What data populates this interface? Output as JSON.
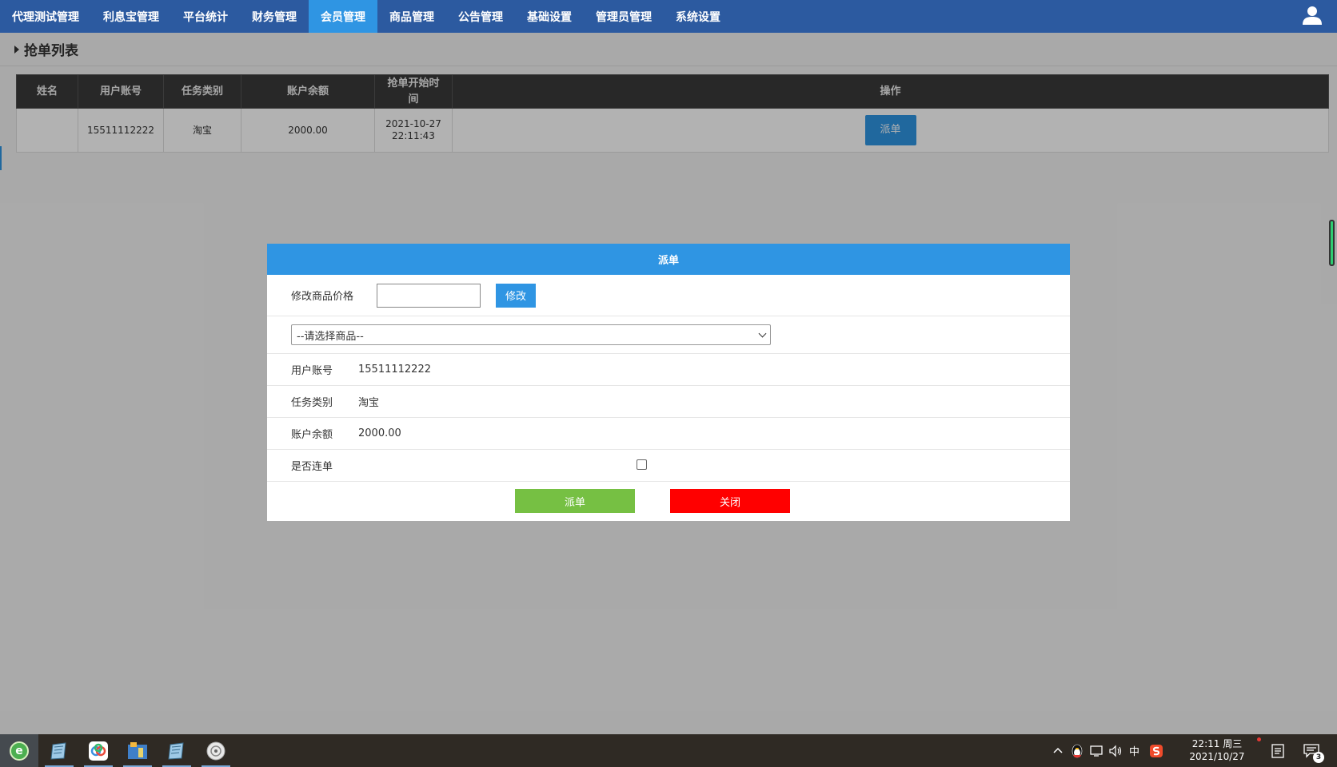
{
  "nav": {
    "items": [
      {
        "label": "代理测试管理"
      },
      {
        "label": "利息宝管理"
      },
      {
        "label": "平台统计"
      },
      {
        "label": "财务管理"
      },
      {
        "label": "会员管理",
        "active": true
      },
      {
        "label": "商品管理"
      },
      {
        "label": "公告管理"
      },
      {
        "label": "基础设置"
      },
      {
        "label": "管理员管理"
      },
      {
        "label": "系统设置"
      }
    ],
    "user_icon": "user-icon"
  },
  "page": {
    "title": "抢单列表"
  },
  "table": {
    "headers": [
      "姓名",
      "用户账号",
      "任务类别",
      "账户余额",
      "抢单开始时间",
      "操作"
    ],
    "rows": [
      {
        "name": "",
        "account": "15511112222",
        "task_type": "淘宝",
        "balance": "2000.00",
        "start_date": "2021-10-27",
        "start_time": "22:11:43",
        "action_label": "派单"
      }
    ]
  },
  "modal": {
    "title": "派单",
    "price_label": "修改商品价格",
    "price_value": "",
    "modify_label": "修改",
    "product_select": "--请选择商品--",
    "fields": [
      {
        "label": "用户账号",
        "value": "15511112222"
      },
      {
        "label": "任务类别",
        "value": "淘宝"
      },
      {
        "label": "账户余额",
        "value": "2000.00"
      }
    ],
    "continuous_label": "是否连单",
    "continuous_checked": false,
    "confirm_label": "派单",
    "close_label": "关闭"
  },
  "taskbar": {
    "tray": {
      "ime": "中"
    },
    "clock": {
      "time": "22:11 周三",
      "date": "2021/10/27"
    },
    "notification_count": "3"
  },
  "colors": {
    "nav_bg": "#2c5aa0",
    "accent": "#2f95e3",
    "confirm": "#76c043",
    "danger": "#ff0000"
  }
}
